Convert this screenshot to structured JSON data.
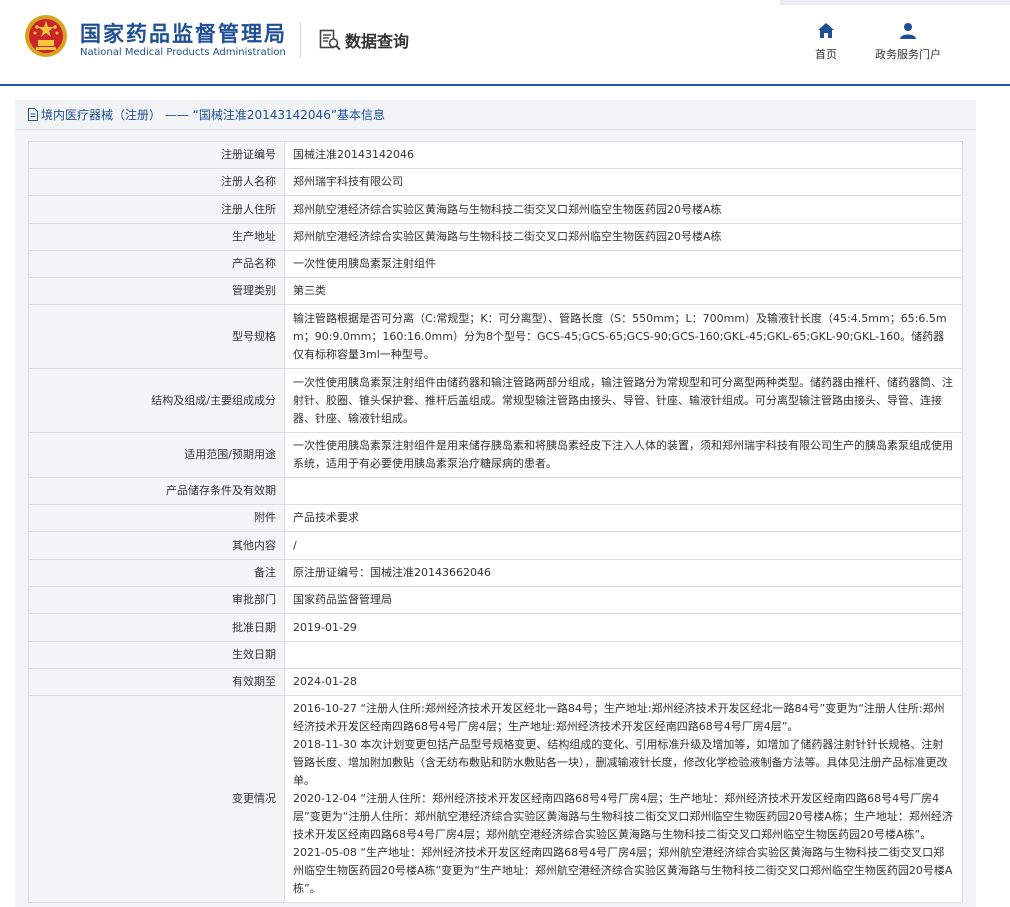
{
  "header": {
    "brand_cn": "国家药品监督管理局",
    "brand_en": "National Medical Products Administration",
    "query_label": "数据查询",
    "nav": [
      {
        "label": "首页",
        "icon": "home-icon"
      },
      {
        "label": "政务服务门户",
        "icon": "user-icon"
      }
    ]
  },
  "panel": {
    "title": "境内医疗器械（注册） —— “国械注准20143142046”基本信息"
  },
  "rows": [
    {
      "label": "注册证编号",
      "value": "国械注准20143142046"
    },
    {
      "label": "注册人名称",
      "value": "郑州瑞宇科技有限公司"
    },
    {
      "label": "注册人住所",
      "value": "郑州航空港经济综合实验区黄海路与生物科技二街交叉口郑州临空生物医药园20号楼A栋"
    },
    {
      "label": "生产地址",
      "value": "郑州航空港经济综合实验区黄海路与生物科技二街交叉口郑州临空生物医药园20号楼A栋"
    },
    {
      "label": "产品名称",
      "value": "一次性使用胰岛素泵注射组件"
    },
    {
      "label": "管理类别",
      "value": "第三类"
    },
    {
      "label": "型号规格",
      "value": "输注管路根据是否可分离（C:常规型；K：可分离型）、管路长度（S：550mm；L：700mm）及输液针长度（45:4.5mm；65:6.5mm；90:9.0mm；160:16.0mm）分为8个型号：GCS-45;GCS-65;GCS-90;GCS-160;GKL-45;GKL-65;GKL-90;GKL-160。储药器仅有标称容量3ml一种型号。"
    },
    {
      "label": "结构及组成/主要组成成分",
      "value": "一次性使用胰岛素泵注射组件由储药器和输注管路两部分组成，输注管路分为常规型和可分离型两种类型。储药器由推杆、储药器筒、注射针、胶圈、锥头保护套、推杆后盖组成。常规型输注管路由接头、导管、针座、输液针组成。可分离型输注管路由接头、导管、连接器、针座、输液针组成。"
    },
    {
      "label": "适用范围/预期用途",
      "value": "一次性使用胰岛素泵注射组件是用来储存胰岛素和将胰岛素经皮下注入人体的装置，须和郑州瑞宇科技有限公司生产的胰岛素泵组成使用系统，适用于有必要使用胰岛素泵治疗糖尿病的患者。"
    },
    {
      "label": "产品储存条件及有效期",
      "value": ""
    },
    {
      "label": "附件",
      "value": "产品技术要求"
    },
    {
      "label": "其他内容",
      "value": "/"
    },
    {
      "label": "备注",
      "value": "原注册证编号：国械注准20143662046"
    },
    {
      "label": "审批部门",
      "value": "国家药品监督管理局"
    },
    {
      "label": "批准日期",
      "value": "2019-01-29"
    },
    {
      "label": "生效日期",
      "value": ""
    },
    {
      "label": "有效期至",
      "value": "2024-01-28"
    }
  ],
  "changes": {
    "label": "变更情况",
    "entries": [
      "2016-10-27 “注册人住所:郑州经济技术开发区经北一路84号；生产地址:郑州经济技术开发区经北一路84号”变更为“注册人住所:郑州经济技术开发区经南四路68号4号厂房4层；生产地址:郑州经济技术开发区经南四路68号4号厂房4层”。",
      "2018-11-30 本次计划变更包括产品型号规格变更、结构组成的变化、引用标准升级及增加等，如增加了储药器注射针针长规格、注射管路长度、增加附加敷贴（含无纺布敷贴和防水敷贴各一块），删减输液针长度，修改化学检验液制备方法等。具体见注册产品标准更改单。",
      "2020-12-04 “注册人住所：郑州经济技术开发区经南四路68号4号厂房4层；生产地址：郑州经济技术开发区经南四路68号4号厂房4层”变更为“注册人住所：郑州航空港经济综合实验区黄海路与生物科技二街交叉口郑州临空生物医药园20号楼A栋；生产地址：郑州经济技术开发区经南四路68号4号厂房4层；郑州航空港经济综合实验区黄海路与生物科技二街交叉口郑州临空生物医药园20号楼A栋”。",
      "2021-05-08 “生产地址：郑州经济技术开发区经南四路68号4号厂房4层；郑州航空港经济综合实验区黄海路与生物科技二街交叉口郑州临空生物医药园20号楼A栋”变更为“生产地址：郑州航空港经济综合实验区黄海路与生物科技二街交叉口郑州临空生物医药园20号楼A栋”。"
    ]
  },
  "colors": {
    "brand": "#1f4f96",
    "header_rule": "#1f5aa6",
    "label_bg": "#f4f5f7",
    "panel_bg": "#f2f3f5"
  }
}
